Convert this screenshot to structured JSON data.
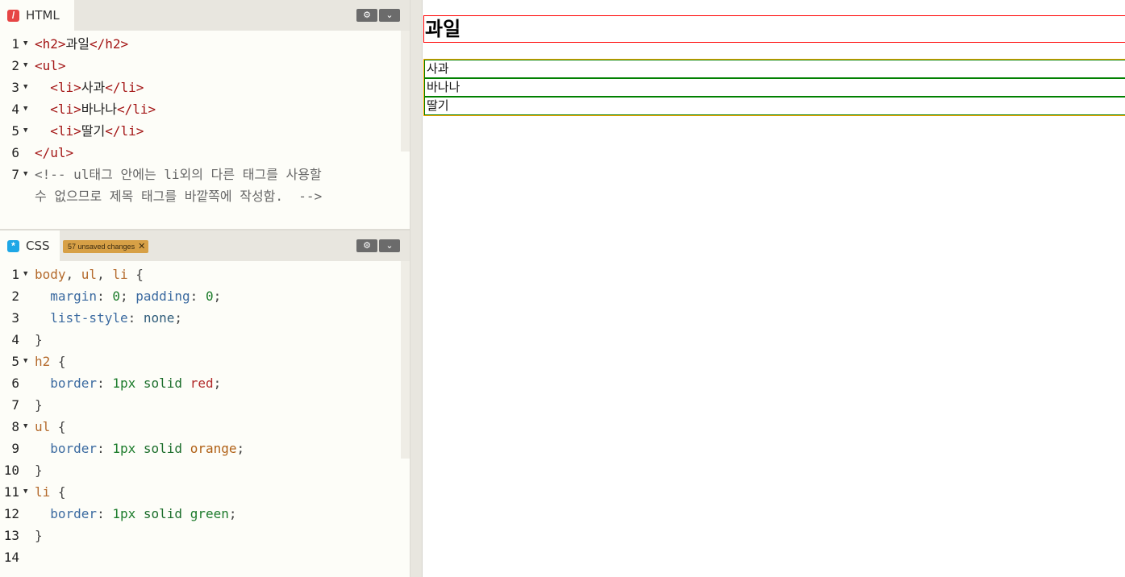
{
  "html_panel": {
    "tab_label": "HTML",
    "lines": [
      {
        "n": "1",
        "fold": true,
        "segments": [
          [
            "tag",
            "<h2>"
          ],
          [
            "plain",
            "과일"
          ],
          [
            "tag",
            "</h2>"
          ]
        ]
      },
      {
        "n": "2",
        "fold": true,
        "segments": [
          [
            "tag",
            "<ul>"
          ]
        ]
      },
      {
        "n": "3",
        "fold": true,
        "segments": [
          [
            "plain",
            "  "
          ],
          [
            "tag",
            "<li>"
          ],
          [
            "plain",
            "사과"
          ],
          [
            "tag",
            "</li>"
          ]
        ]
      },
      {
        "n": "4",
        "fold": true,
        "segments": [
          [
            "plain",
            "  "
          ],
          [
            "tag",
            "<li>"
          ],
          [
            "plain",
            "바나나"
          ],
          [
            "tag",
            "</li>"
          ]
        ]
      },
      {
        "n": "5",
        "fold": true,
        "segments": [
          [
            "plain",
            "  "
          ],
          [
            "tag",
            "<li>"
          ],
          [
            "plain",
            "딸기"
          ],
          [
            "tag",
            "</li>"
          ]
        ]
      },
      {
        "n": "6",
        "fold": false,
        "segments": [
          [
            "tag",
            "</ul>"
          ]
        ]
      },
      {
        "n": "7",
        "fold": true,
        "segments": [
          [
            "cmt",
            "<!-- ul태그 안에는 li외의 다른 태그를 사용할"
          ]
        ]
      },
      {
        "n": "",
        "fold": false,
        "segments": [
          [
            "cmt",
            "수 없으므로 제목 태그를 바깥쪽에 작성함.  -->"
          ]
        ]
      }
    ]
  },
  "css_panel": {
    "tab_label": "CSS",
    "unsaved_badge": "57 unsaved changes",
    "lines": [
      {
        "n": "1",
        "fold": true,
        "segments": [
          [
            "sel",
            "body"
          ],
          [
            "punc",
            ", "
          ],
          [
            "sel",
            "ul"
          ],
          [
            "punc",
            ", "
          ],
          [
            "sel",
            "li"
          ],
          [
            "punc",
            " {"
          ]
        ]
      },
      {
        "n": "2",
        "fold": false,
        "segments": [
          [
            "plain",
            "  "
          ],
          [
            "prop",
            "margin"
          ],
          [
            "punc",
            ": "
          ],
          [
            "num",
            "0"
          ],
          [
            "punc",
            "; "
          ],
          [
            "prop",
            "padding"
          ],
          [
            "punc",
            ": "
          ],
          [
            "num",
            "0"
          ],
          [
            "punc",
            ";"
          ]
        ]
      },
      {
        "n": "3",
        "fold": false,
        "segments": [
          [
            "plain",
            "  "
          ],
          [
            "prop",
            "list-style"
          ],
          [
            "punc",
            ": "
          ],
          [
            "kwv",
            "none"
          ],
          [
            "punc",
            ";"
          ]
        ]
      },
      {
        "n": "4",
        "fold": false,
        "segments": [
          [
            "punc",
            "}"
          ]
        ]
      },
      {
        "n": "5",
        "fold": true,
        "segments": [
          [
            "sel",
            "h2"
          ],
          [
            "punc",
            " {"
          ]
        ]
      },
      {
        "n": "6",
        "fold": false,
        "segments": [
          [
            "plain",
            "  "
          ],
          [
            "prop",
            "border"
          ],
          [
            "punc",
            ": "
          ],
          [
            "num",
            "1px"
          ],
          [
            "plain",
            " "
          ],
          [
            "kw",
            "solid"
          ],
          [
            "plain",
            " "
          ],
          [
            "col-red",
            "red"
          ],
          [
            "punc",
            ";"
          ]
        ]
      },
      {
        "n": "7",
        "fold": false,
        "segments": [
          [
            "punc",
            "}"
          ]
        ]
      },
      {
        "n": "8",
        "fold": true,
        "segments": [
          [
            "sel",
            "ul"
          ],
          [
            "punc",
            " {"
          ]
        ]
      },
      {
        "n": "9",
        "fold": false,
        "segments": [
          [
            "plain",
            "  "
          ],
          [
            "prop",
            "border"
          ],
          [
            "punc",
            ": "
          ],
          [
            "num",
            "1px"
          ],
          [
            "plain",
            " "
          ],
          [
            "kw",
            "solid"
          ],
          [
            "plain",
            " "
          ],
          [
            "col-org",
            "orange"
          ],
          [
            "punc",
            ";"
          ]
        ]
      },
      {
        "n": "10",
        "fold": false,
        "segments": [
          [
            "punc",
            "}"
          ]
        ]
      },
      {
        "n": "11",
        "fold": true,
        "segments": [
          [
            "sel",
            "li"
          ],
          [
            "punc",
            " {"
          ]
        ]
      },
      {
        "n": "12",
        "fold": false,
        "segments": [
          [
            "plain",
            "  "
          ],
          [
            "prop",
            "border"
          ],
          [
            "punc",
            ": "
          ],
          [
            "num",
            "1px"
          ],
          [
            "plain",
            " "
          ],
          [
            "kw",
            "solid"
          ],
          [
            "plain",
            " "
          ],
          [
            "col-grn",
            "green"
          ],
          [
            "punc",
            ";"
          ]
        ]
      },
      {
        "n": "13",
        "fold": false,
        "segments": [
          [
            "punc",
            "}"
          ]
        ]
      },
      {
        "n": "14",
        "fold": false,
        "segments": []
      }
    ]
  },
  "icons": {
    "html_tab_icon": "slash-icon",
    "css_tab_icon": "asterisk-icon",
    "settings": "gear-icon",
    "collapse": "chevron-down-icon",
    "close_badge": "close-icon"
  },
  "preview": {
    "heading": "과일",
    "items": [
      "사과",
      "바나나",
      "딸기"
    ]
  },
  "colors": {
    "h2_border": "#ff0000",
    "ul_border": "#ffa500",
    "li_border": "#008000",
    "badge": "#d7a046"
  }
}
